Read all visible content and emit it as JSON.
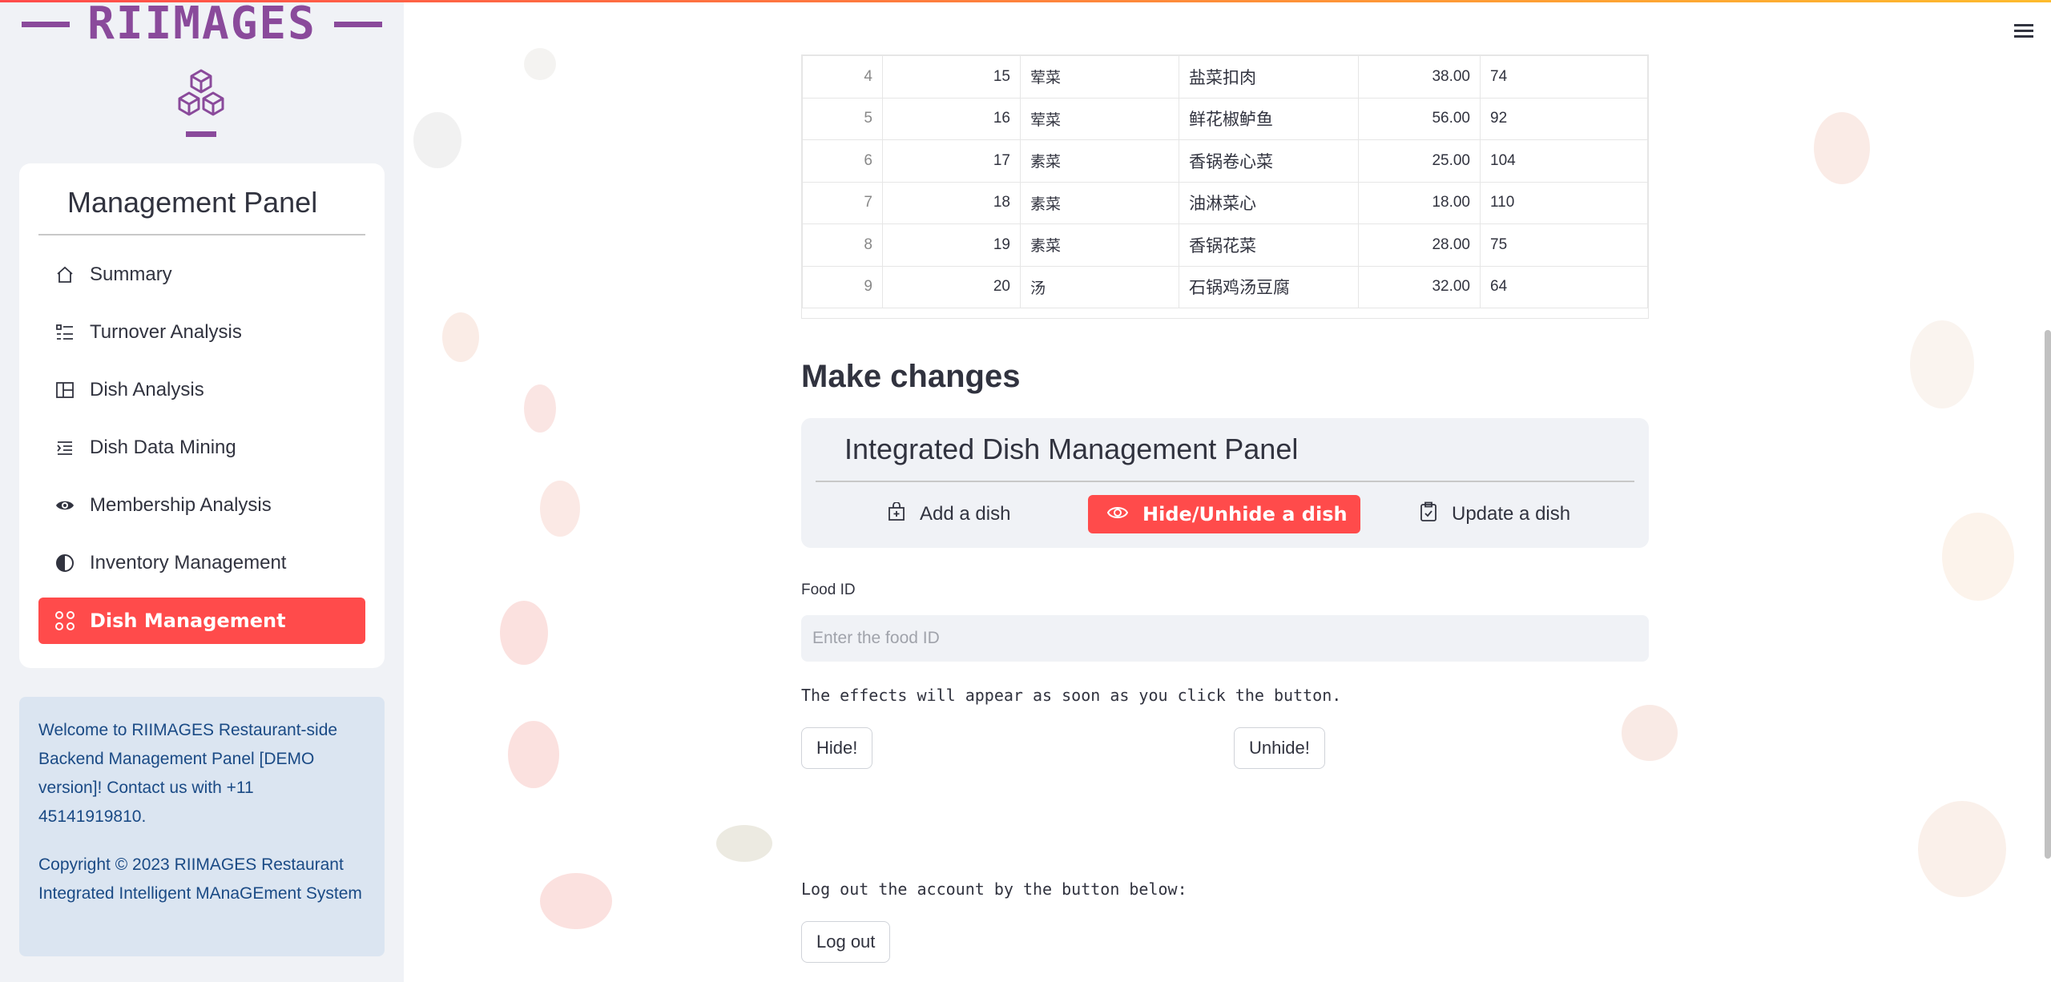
{
  "brand": {
    "name": "RIIMAGES"
  },
  "sidebar": {
    "menu_title": "Management Panel",
    "items": [
      {
        "label": "Summary",
        "icon": "house-icon"
      },
      {
        "label": "Turnover Analysis",
        "icon": "list-check-icon"
      },
      {
        "label": "Dish Analysis",
        "icon": "layout-icon"
      },
      {
        "label": "Dish Data Mining",
        "icon": "text-indent-icon"
      },
      {
        "label": "Membership Analysis",
        "icon": "eye-icon"
      },
      {
        "label": "Inventory Management",
        "icon": "half-circle-icon"
      },
      {
        "label": "Dish Management",
        "icon": "grid-circles-icon",
        "active": true
      }
    ],
    "info_paragraphs": [
      "Welcome to RIIMAGES Restaurant-side Backend Management Panel [DEMO version]! Contact us with +11 45141919810.",
      "Copyright © 2023 RIIMAGES Restaurant Integrated Intelligent MAnaGEment System"
    ]
  },
  "table": {
    "rows": [
      {
        "index": "4",
        "id": "15",
        "category": "荤菜",
        "name": "盐菜扣肉",
        "price": "38.00",
        "count": "74"
      },
      {
        "index": "5",
        "id": "16",
        "category": "荤菜",
        "name": "鲜花椒鲈鱼",
        "price": "56.00",
        "count": "92"
      },
      {
        "index": "6",
        "id": "17",
        "category": "素菜",
        "name": "香锅卷心菜",
        "price": "25.00",
        "count": "104"
      },
      {
        "index": "7",
        "id": "18",
        "category": "素菜",
        "name": "油淋菜心",
        "price": "18.00",
        "count": "110"
      },
      {
        "index": "8",
        "id": "19",
        "category": "素菜",
        "name": "香锅花菜",
        "price": "28.00",
        "count": "75"
      },
      {
        "index": "9",
        "id": "20",
        "category": "汤",
        "name": "石锅鸡汤豆腐",
        "price": "32.00",
        "count": "64"
      }
    ]
  },
  "main": {
    "section_title": "Make changes",
    "panel_title": "Integrated Dish Management Panel",
    "tabs": [
      {
        "label": "Add a dish",
        "icon": "bag-plus-icon"
      },
      {
        "label": "Hide/Unhide a dish",
        "icon": "eye-icon",
        "active": true
      },
      {
        "label": "Update a dish",
        "icon": "clipboard-check-icon"
      }
    ],
    "food_id_label": "Food ID",
    "food_id_placeholder": "Enter the food ID",
    "food_id_value": "",
    "effects_note": "The effects will appear as soon as you click the button.",
    "hide_button": "Hide!",
    "unhide_button": "Unhide!",
    "logout_note": "Log out the account by the button below:",
    "logout_button": "Log out"
  },
  "colors": {
    "accent": "#ff4b4b",
    "brand": "#8a4a9b",
    "sidebar_bg": "#f0f2f6",
    "info_bg": "#dbe5f1",
    "info_text": "#1a4a85"
  }
}
